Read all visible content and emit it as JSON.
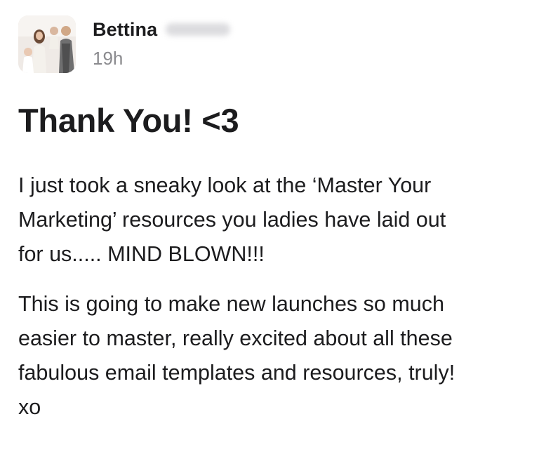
{
  "post": {
    "author": {
      "name": "Bettina",
      "avatar_icon": "family-photo-avatar"
    },
    "timestamp": "19h",
    "title": "Thank You! <3",
    "paragraphs": [
      "I just took a sneaky look at the ‘Master Your\nMarketing’ resources you ladies have laid out\nfor us..... MIND BLOWN!!!",
      "This is going to make new launches so much\neasier to master, really excited about all these\nfabulous email templates and resources, truly!\nxo"
    ]
  },
  "colors": {
    "text": "#1c1c1e",
    "muted": "#8a8a8e",
    "background": "#ffffff"
  }
}
